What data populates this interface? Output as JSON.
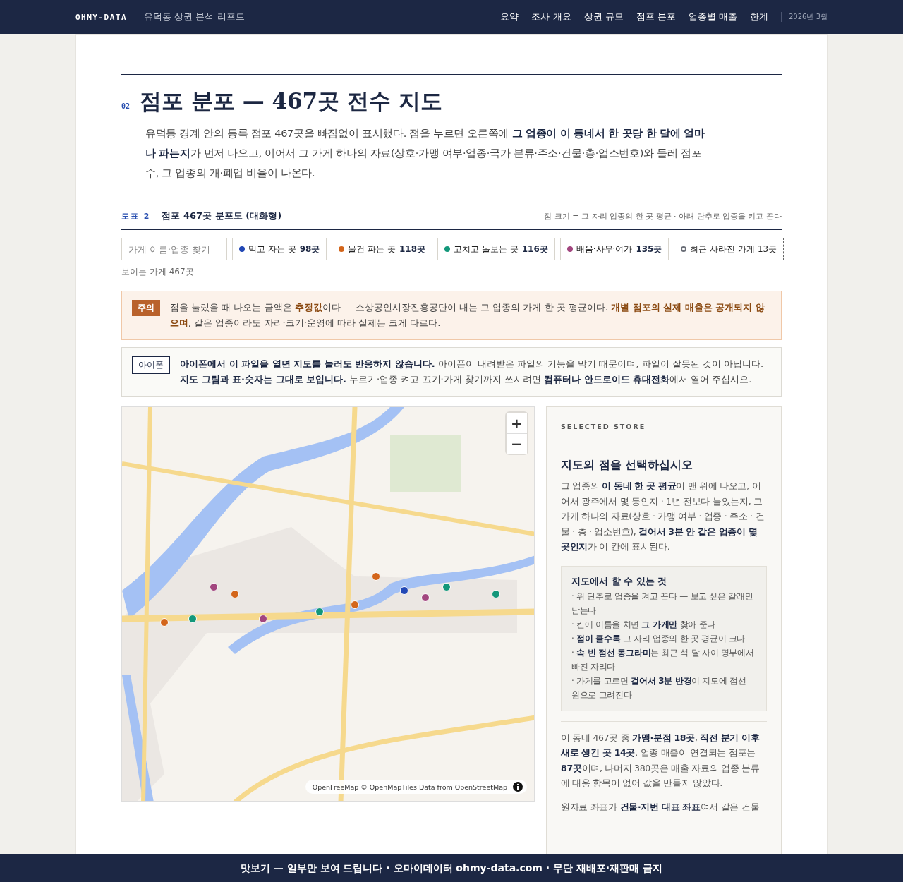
{
  "header": {
    "brand": "OHMY-DATA",
    "subtitle": "유덕동 상권 분석 리포트",
    "nav": [
      "요약",
      "조사 개요",
      "상권 규모",
      "점포 분포",
      "업종별 매출",
      "한계"
    ],
    "date": "2026년 3월"
  },
  "section": {
    "number": "02",
    "title": "점포 분포 — 467곳 전수 지도",
    "intro": "유덕동 경계 안의 등록 점포 467곳을 빠짐없이 표시했다. 점을 누르면 오른쪽에 **그 업종이 이 동네서 한 곳당 한 달에 얼마나 파는지**가 먼저 나오고, 이어서 그 가게 하나의 자료(상호·가맹 여부·업종·국가 분류·주소·건물·층·업소번호)와 둘레 점포 수, 그 업종의 개·폐업 비율이 나온다."
  },
  "figure": {
    "label": "도표 2",
    "title": "점포 467곳 분포도 (대화형)",
    "note": "점 크기 = 그 자리 업종의 한 곳 평균 · 아래 단추로 업종을 켜고 끈다"
  },
  "search": {
    "placeholder": "가게 이름·업종 찾기"
  },
  "filters": [
    {
      "kind": "category",
      "color": "#2248b5",
      "label": "먹고 자는 곳",
      "count": "98곳"
    },
    {
      "kind": "category",
      "color": "#d3651a",
      "label": "물건 파는 곳",
      "count": "118곳"
    },
    {
      "kind": "category",
      "color": "#12977a",
      "label": "고치고 돌보는 곳",
      "count": "116곳"
    },
    {
      "kind": "category",
      "color": "#a2467f",
      "label": "배움·사무·여가",
      "count": "135곳"
    },
    {
      "kind": "closed",
      "color": "#6b6f78",
      "label": "최근 사라진 가게 13곳"
    }
  ],
  "visible_count": "보이는 가게 467곳",
  "notices": [
    {
      "kind": "warning",
      "badge": "주의",
      "text": "점을 눌렀을 때 나오는 금액은 **추정값**이다 — 소상공인시장진흥공단이 내는 그 업종의 가게 한 곳 평균이다. **개별 점포의 실제 매출은 공개되지 않으며**, 같은 업종이라도 자리·크기·운영에 따라 실제는 크게 다르다."
    },
    {
      "kind": "info",
      "badge": "아이폰",
      "text": "**아이폰에서 이 파일을 열면 지도를 눌러도 반응하지 않습니다.** 아이폰이 내려받은 파일의 기능을 막기 때문이며, 파일이 잘못된 것이 아닙니다. **지도 그림과 표·숫자는 그대로 보입니다.** 누르기·업종 켜고 끄기·가게 찾기까지 쓰시려면 **컴퓨터나 안드로이드 휴대전화**에서 열어 주십시오."
    }
  ],
  "map": {
    "kind": "picture",
    "zoom": [
      "+",
      "−"
    ],
    "attribution": "OpenFreeMap © OpenMapTiles Data from OpenStreetMap"
  },
  "panel": {
    "eyebrow": "SELECTED STORE",
    "title": "지도의 점을 선택하십시오",
    "body": "그 업종의 **이 동네 한 곳 평균**이 맨 위에 나오고, 이어서 광주에서 몇 등인지 · 1년 전보다 늘었는지, 그 가게 하나의 자료(상호 · 가맹 여부 · 업종 · 주소 · 건물 · 층 · 업소번호), **걸어서 3분 안 같은 업종이 몇 곳인지**가 이 칸에 표시된다.",
    "help_title": "지도에서 할 수 있는 것",
    "help": [
      "· 위 단추로 업종을 켜고 끈다 — 보고 싶은 갈래만 남는다",
      "· 칸에 이름을 치면 **그 가게만** 찾아 준다",
      "· **점이 클수록** 그 자리 업종의 한 곳 평균이 크다",
      "· **속 빈 점선 동그라미**는 최근 석 달 사이 명부에서 빠진 자리다",
      "· 가게를 고르면 **걸어서 3분 반경**이 지도에 점선 원으로 그려진다"
    ],
    "paragraphs": [
      "이 동네 467곳 중 **가맹·분점 18곳**, **직전 분기 이후 새로 생긴 곳 14곳**. 업종 매출이 연결되는 점포는 **87곳**이며, 나머지 380곳은 매출 자료의 업종 분류에 대응 항목이 없어 값을 만들지 않았다.",
      "원자료 좌표가 **건물·지번 대표 좌표**여서 같은 건물"
    ]
  },
  "footer": "맛보기 — 일부만 보여 드립니다 · 오마이데이터 ohmy-data.com · 무단 재배포·재판매 금지"
}
